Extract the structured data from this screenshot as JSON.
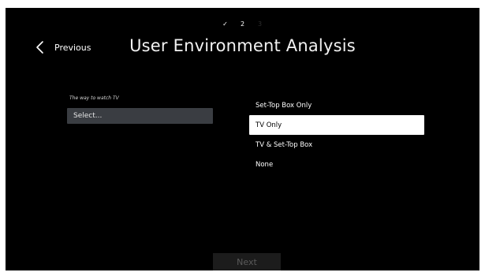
{
  "steps": {
    "step1": "✓",
    "step2": "2",
    "step3": "3"
  },
  "header": {
    "back_label": "Previous",
    "title": "User Environment Analysis"
  },
  "form": {
    "field_label": "The way to watch TV",
    "select_value": "Select..."
  },
  "options": [
    {
      "label": "Set-Top Box Only",
      "selected": false
    },
    {
      "label": "TV Only",
      "selected": true
    },
    {
      "label": "TV & Set-Top Box",
      "selected": false
    },
    {
      "label": "None",
      "selected": false
    }
  ],
  "footer": {
    "next_label": "Next"
  },
  "colors": {
    "background": "#000000",
    "select_bg": "#3a3d42",
    "selected_option_bg": "#ffffff",
    "next_bg": "#1c1c1c",
    "next_text": "#5a5a5a"
  },
  "icons": {
    "back": "chevron-left-icon",
    "completed_step": "checkmark-icon"
  }
}
